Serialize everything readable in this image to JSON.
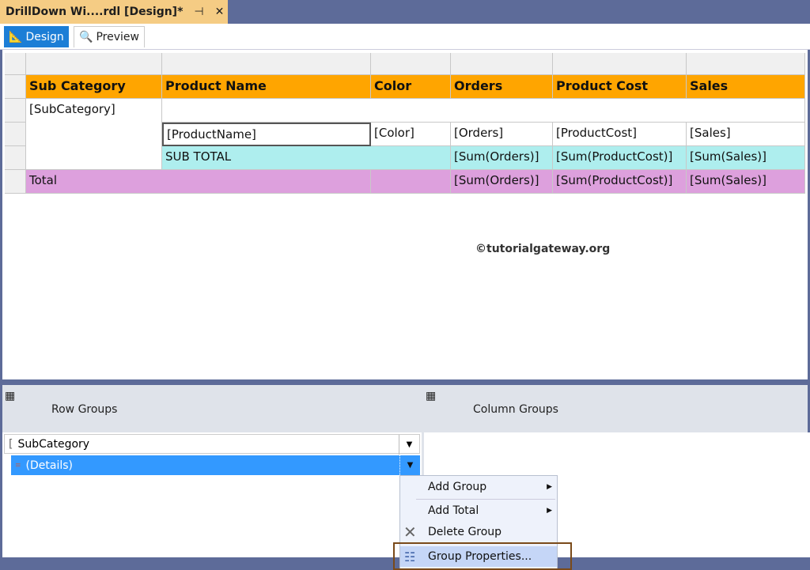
{
  "tab": {
    "title": "DrillDown Wi....rdl [Design]*",
    "pin": "⊣",
    "close": "✕"
  },
  "toolbar": {
    "design": "Design",
    "preview": "Preview"
  },
  "table": {
    "headers": [
      "Sub Category",
      "Product Name",
      "Color",
      "Orders",
      "Product Cost",
      "Sales"
    ],
    "group_row": "[SubCategory]",
    "detail": [
      "[ProductName]",
      "[Color]",
      "[Orders]",
      "[ProductCost]",
      "[Sales]"
    ],
    "subtotal": [
      "SUB TOTAL",
      "[Sum(Orders)]",
      "[Sum(ProductCost)]",
      "[Sum(Sales)]"
    ],
    "total": [
      "Total",
      "[Sum(Orders)]",
      "[Sum(ProductCost)]",
      "[Sum(Sales)]"
    ]
  },
  "colors": {
    "header": "#ffa500",
    "subtotal": "#aeeeee",
    "total": "#dda0dd"
  },
  "watermark": "©tutorialgateway.org",
  "groups": {
    "row_title": "Row Groups",
    "col_title": "Column Groups",
    "rows": [
      "SubCategory",
      "(Details)"
    ]
  },
  "menu": [
    "Add Group",
    "Add Total",
    "Delete Group",
    "Group Properties..."
  ]
}
